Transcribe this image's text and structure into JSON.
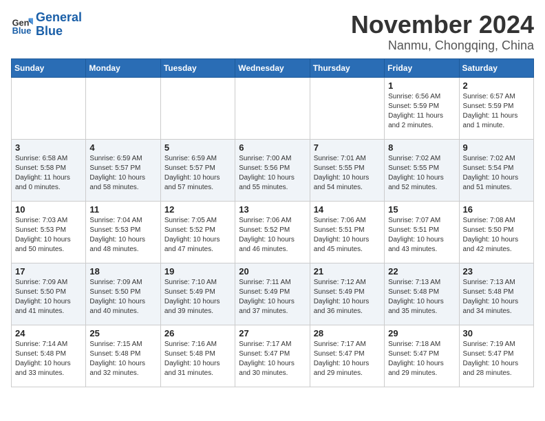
{
  "header": {
    "logo_line1": "General",
    "logo_line2": "Blue",
    "month": "November 2024",
    "location": "Nanmu, Chongqing, China"
  },
  "days_of_week": [
    "Sunday",
    "Monday",
    "Tuesday",
    "Wednesday",
    "Thursday",
    "Friday",
    "Saturday"
  ],
  "weeks": [
    [
      {
        "day": "",
        "info": ""
      },
      {
        "day": "",
        "info": ""
      },
      {
        "day": "",
        "info": ""
      },
      {
        "day": "",
        "info": ""
      },
      {
        "day": "",
        "info": ""
      },
      {
        "day": "1",
        "info": "Sunrise: 6:56 AM\nSunset: 5:59 PM\nDaylight: 11 hours and 2 minutes."
      },
      {
        "day": "2",
        "info": "Sunrise: 6:57 AM\nSunset: 5:59 PM\nDaylight: 11 hours and 1 minute."
      }
    ],
    [
      {
        "day": "3",
        "info": "Sunrise: 6:58 AM\nSunset: 5:58 PM\nDaylight: 11 hours and 0 minutes."
      },
      {
        "day": "4",
        "info": "Sunrise: 6:59 AM\nSunset: 5:57 PM\nDaylight: 10 hours and 58 minutes."
      },
      {
        "day": "5",
        "info": "Sunrise: 6:59 AM\nSunset: 5:57 PM\nDaylight: 10 hours and 57 minutes."
      },
      {
        "day": "6",
        "info": "Sunrise: 7:00 AM\nSunset: 5:56 PM\nDaylight: 10 hours and 55 minutes."
      },
      {
        "day": "7",
        "info": "Sunrise: 7:01 AM\nSunset: 5:55 PM\nDaylight: 10 hours and 54 minutes."
      },
      {
        "day": "8",
        "info": "Sunrise: 7:02 AM\nSunset: 5:55 PM\nDaylight: 10 hours and 52 minutes."
      },
      {
        "day": "9",
        "info": "Sunrise: 7:02 AM\nSunset: 5:54 PM\nDaylight: 10 hours and 51 minutes."
      }
    ],
    [
      {
        "day": "10",
        "info": "Sunrise: 7:03 AM\nSunset: 5:53 PM\nDaylight: 10 hours and 50 minutes."
      },
      {
        "day": "11",
        "info": "Sunrise: 7:04 AM\nSunset: 5:53 PM\nDaylight: 10 hours and 48 minutes."
      },
      {
        "day": "12",
        "info": "Sunrise: 7:05 AM\nSunset: 5:52 PM\nDaylight: 10 hours and 47 minutes."
      },
      {
        "day": "13",
        "info": "Sunrise: 7:06 AM\nSunset: 5:52 PM\nDaylight: 10 hours and 46 minutes."
      },
      {
        "day": "14",
        "info": "Sunrise: 7:06 AM\nSunset: 5:51 PM\nDaylight: 10 hours and 45 minutes."
      },
      {
        "day": "15",
        "info": "Sunrise: 7:07 AM\nSunset: 5:51 PM\nDaylight: 10 hours and 43 minutes."
      },
      {
        "day": "16",
        "info": "Sunrise: 7:08 AM\nSunset: 5:50 PM\nDaylight: 10 hours and 42 minutes."
      }
    ],
    [
      {
        "day": "17",
        "info": "Sunrise: 7:09 AM\nSunset: 5:50 PM\nDaylight: 10 hours and 41 minutes."
      },
      {
        "day": "18",
        "info": "Sunrise: 7:09 AM\nSunset: 5:50 PM\nDaylight: 10 hours and 40 minutes."
      },
      {
        "day": "19",
        "info": "Sunrise: 7:10 AM\nSunset: 5:49 PM\nDaylight: 10 hours and 39 minutes."
      },
      {
        "day": "20",
        "info": "Sunrise: 7:11 AM\nSunset: 5:49 PM\nDaylight: 10 hours and 37 minutes."
      },
      {
        "day": "21",
        "info": "Sunrise: 7:12 AM\nSunset: 5:49 PM\nDaylight: 10 hours and 36 minutes."
      },
      {
        "day": "22",
        "info": "Sunrise: 7:13 AM\nSunset: 5:48 PM\nDaylight: 10 hours and 35 minutes."
      },
      {
        "day": "23",
        "info": "Sunrise: 7:13 AM\nSunset: 5:48 PM\nDaylight: 10 hours and 34 minutes."
      }
    ],
    [
      {
        "day": "24",
        "info": "Sunrise: 7:14 AM\nSunset: 5:48 PM\nDaylight: 10 hours and 33 minutes."
      },
      {
        "day": "25",
        "info": "Sunrise: 7:15 AM\nSunset: 5:48 PM\nDaylight: 10 hours and 32 minutes."
      },
      {
        "day": "26",
        "info": "Sunrise: 7:16 AM\nSunset: 5:48 PM\nDaylight: 10 hours and 31 minutes."
      },
      {
        "day": "27",
        "info": "Sunrise: 7:17 AM\nSunset: 5:47 PM\nDaylight: 10 hours and 30 minutes."
      },
      {
        "day": "28",
        "info": "Sunrise: 7:17 AM\nSunset: 5:47 PM\nDaylight: 10 hours and 29 minutes."
      },
      {
        "day": "29",
        "info": "Sunrise: 7:18 AM\nSunset: 5:47 PM\nDaylight: 10 hours and 29 minutes."
      },
      {
        "day": "30",
        "info": "Sunrise: 7:19 AM\nSunset: 5:47 PM\nDaylight: 10 hours and 28 minutes."
      }
    ]
  ]
}
